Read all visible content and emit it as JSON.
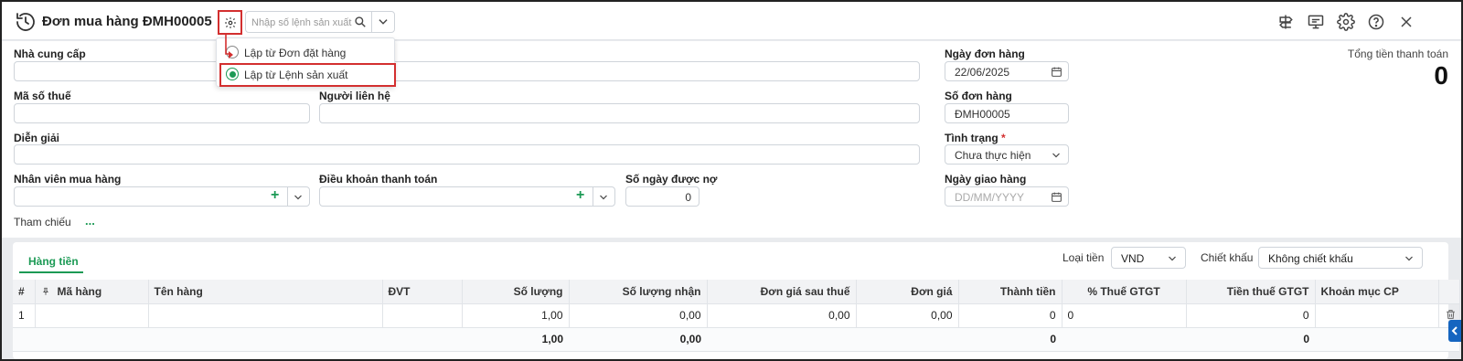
{
  "header": {
    "title": "Đơn mua hàng ĐMH00005",
    "search_placeholder": "Nhập số lệnh sản xuất"
  },
  "popup": {
    "options": [
      {
        "label": "Lập từ Đơn đặt hàng",
        "selected": false
      },
      {
        "label": "Lập từ Lệnh sản xuất",
        "selected": true
      }
    ]
  },
  "form": {
    "supplier_label": "Nhà cung cấp",
    "supplier_value": "",
    "tax_code_label": "Mã số thuế",
    "contact_label": "Người liên hệ",
    "description_label": "Diễn giải",
    "buyer_label": "Nhân viên mua hàng",
    "payment_terms_label": "Điều khoản thanh toán",
    "credit_days_label": "Số ngày được nợ",
    "credit_days_value": "0",
    "order_date_label": "Ngày đơn hàng",
    "order_date_value": "22/06/2025",
    "order_no_label": "Số đơn hàng",
    "order_no_value": "ĐMH00005",
    "status_label": "Tình trạng",
    "status_required": "*",
    "status_value": "Chưa thực hiện",
    "delivery_date_label": "Ngày giao hàng",
    "delivery_date_placeholder": "DD/MM/YYYY",
    "total_label": "Tổng tiền thanh toán",
    "total_value": "0",
    "reference_label": "Tham chiếu",
    "reference_more": "..."
  },
  "detail": {
    "tab_label": "Hàng tiền",
    "currency_label": "Loại tiền",
    "currency_value": "VND",
    "discount_label": "Chiết khấu",
    "discount_value": "Không chiết khấu",
    "columns": [
      "#",
      "Mã hàng",
      "Tên hàng",
      "ĐVT",
      "Số lượng",
      "Số lượng nhận",
      "Đơn giá sau thuế",
      "Đơn giá",
      "Thành tiền",
      "% Thuế GTGT",
      "Tiền thuế GTGT",
      "Khoản mục CP"
    ],
    "rows": [
      {
        "no": "1",
        "code": "",
        "name": "",
        "unit": "",
        "qty": "1,00",
        "qty_received": "0,00",
        "price_after_tax": "0,00",
        "price": "0,00",
        "amount": "0",
        "vat_pct": "0",
        "vat_amount": "0",
        "cost_item": ""
      }
    ],
    "totals": {
      "qty": "1,00",
      "qty_received": "0,00",
      "amount": "0",
      "vat_amount": "0"
    }
  },
  "colors": {
    "accent": "#1c9a55",
    "highlight": "#d32f2f"
  }
}
